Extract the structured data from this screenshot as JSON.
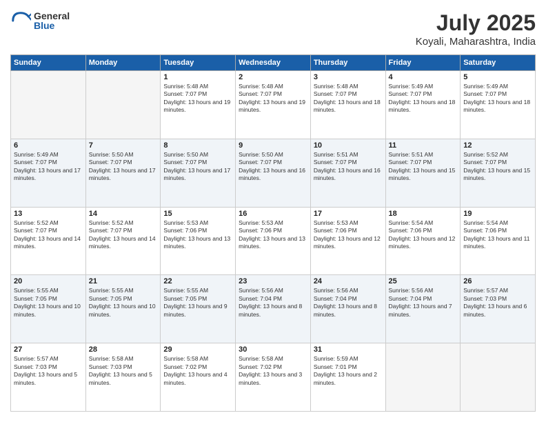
{
  "header": {
    "logo_general": "General",
    "logo_blue": "Blue",
    "month": "July 2025",
    "location": "Koyali, Maharashtra, India"
  },
  "weekdays": [
    "Sunday",
    "Monday",
    "Tuesday",
    "Wednesday",
    "Thursday",
    "Friday",
    "Saturday"
  ],
  "weeks": [
    [
      {
        "day": "",
        "text": ""
      },
      {
        "day": "",
        "text": ""
      },
      {
        "day": "1",
        "text": "Sunrise: 5:48 AM\nSunset: 7:07 PM\nDaylight: 13 hours and 19 minutes."
      },
      {
        "day": "2",
        "text": "Sunrise: 5:48 AM\nSunset: 7:07 PM\nDaylight: 13 hours and 19 minutes."
      },
      {
        "day": "3",
        "text": "Sunrise: 5:48 AM\nSunset: 7:07 PM\nDaylight: 13 hours and 18 minutes."
      },
      {
        "day": "4",
        "text": "Sunrise: 5:49 AM\nSunset: 7:07 PM\nDaylight: 13 hours and 18 minutes."
      },
      {
        "day": "5",
        "text": "Sunrise: 5:49 AM\nSunset: 7:07 PM\nDaylight: 13 hours and 18 minutes."
      }
    ],
    [
      {
        "day": "6",
        "text": "Sunrise: 5:49 AM\nSunset: 7:07 PM\nDaylight: 13 hours and 17 minutes."
      },
      {
        "day": "7",
        "text": "Sunrise: 5:50 AM\nSunset: 7:07 PM\nDaylight: 13 hours and 17 minutes."
      },
      {
        "day": "8",
        "text": "Sunrise: 5:50 AM\nSunset: 7:07 PM\nDaylight: 13 hours and 17 minutes."
      },
      {
        "day": "9",
        "text": "Sunrise: 5:50 AM\nSunset: 7:07 PM\nDaylight: 13 hours and 16 minutes."
      },
      {
        "day": "10",
        "text": "Sunrise: 5:51 AM\nSunset: 7:07 PM\nDaylight: 13 hours and 16 minutes."
      },
      {
        "day": "11",
        "text": "Sunrise: 5:51 AM\nSunset: 7:07 PM\nDaylight: 13 hours and 15 minutes."
      },
      {
        "day": "12",
        "text": "Sunrise: 5:52 AM\nSunset: 7:07 PM\nDaylight: 13 hours and 15 minutes."
      }
    ],
    [
      {
        "day": "13",
        "text": "Sunrise: 5:52 AM\nSunset: 7:07 PM\nDaylight: 13 hours and 14 minutes."
      },
      {
        "day": "14",
        "text": "Sunrise: 5:52 AM\nSunset: 7:07 PM\nDaylight: 13 hours and 14 minutes."
      },
      {
        "day": "15",
        "text": "Sunrise: 5:53 AM\nSunset: 7:06 PM\nDaylight: 13 hours and 13 minutes."
      },
      {
        "day": "16",
        "text": "Sunrise: 5:53 AM\nSunset: 7:06 PM\nDaylight: 13 hours and 13 minutes."
      },
      {
        "day": "17",
        "text": "Sunrise: 5:53 AM\nSunset: 7:06 PM\nDaylight: 13 hours and 12 minutes."
      },
      {
        "day": "18",
        "text": "Sunrise: 5:54 AM\nSunset: 7:06 PM\nDaylight: 13 hours and 12 minutes."
      },
      {
        "day": "19",
        "text": "Sunrise: 5:54 AM\nSunset: 7:06 PM\nDaylight: 13 hours and 11 minutes."
      }
    ],
    [
      {
        "day": "20",
        "text": "Sunrise: 5:55 AM\nSunset: 7:05 PM\nDaylight: 13 hours and 10 minutes."
      },
      {
        "day": "21",
        "text": "Sunrise: 5:55 AM\nSunset: 7:05 PM\nDaylight: 13 hours and 10 minutes."
      },
      {
        "day": "22",
        "text": "Sunrise: 5:55 AM\nSunset: 7:05 PM\nDaylight: 13 hours and 9 minutes."
      },
      {
        "day": "23",
        "text": "Sunrise: 5:56 AM\nSunset: 7:04 PM\nDaylight: 13 hours and 8 minutes."
      },
      {
        "day": "24",
        "text": "Sunrise: 5:56 AM\nSunset: 7:04 PM\nDaylight: 13 hours and 8 minutes."
      },
      {
        "day": "25",
        "text": "Sunrise: 5:56 AM\nSunset: 7:04 PM\nDaylight: 13 hours and 7 minutes."
      },
      {
        "day": "26",
        "text": "Sunrise: 5:57 AM\nSunset: 7:03 PM\nDaylight: 13 hours and 6 minutes."
      }
    ],
    [
      {
        "day": "27",
        "text": "Sunrise: 5:57 AM\nSunset: 7:03 PM\nDaylight: 13 hours and 5 minutes."
      },
      {
        "day": "28",
        "text": "Sunrise: 5:58 AM\nSunset: 7:03 PM\nDaylight: 13 hours and 5 minutes."
      },
      {
        "day": "29",
        "text": "Sunrise: 5:58 AM\nSunset: 7:02 PM\nDaylight: 13 hours and 4 minutes."
      },
      {
        "day": "30",
        "text": "Sunrise: 5:58 AM\nSunset: 7:02 PM\nDaylight: 13 hours and 3 minutes."
      },
      {
        "day": "31",
        "text": "Sunrise: 5:59 AM\nSunset: 7:01 PM\nDaylight: 13 hours and 2 minutes."
      },
      {
        "day": "",
        "text": ""
      },
      {
        "day": "",
        "text": ""
      }
    ]
  ]
}
